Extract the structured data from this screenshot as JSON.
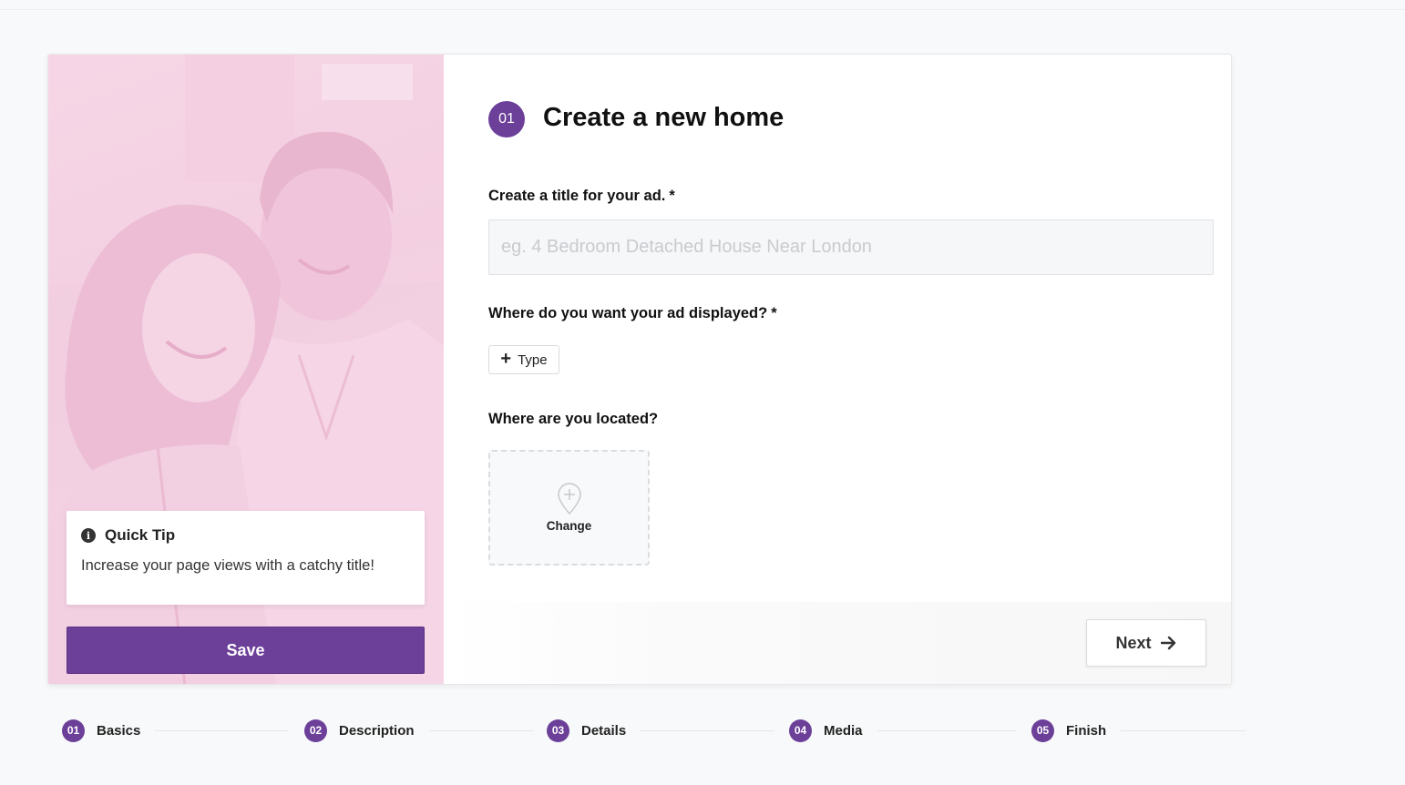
{
  "form": {
    "step_number": "01",
    "title": "Create a new home",
    "title_field": {
      "label": "Create a title for your ad.",
      "required_mark": "*",
      "placeholder": "eg. 4 Bedroom Detached House Near London",
      "value": ""
    },
    "display_field": {
      "label": "Where do you want your ad displayed?",
      "required_mark": "*",
      "type_button": "Type"
    },
    "location_field": {
      "label": "Where are you located?",
      "change_label": "Change"
    },
    "next_button": "Next"
  },
  "sidebar": {
    "tip_title": "Quick Tip",
    "tip_text": "Increase your page views with a catchy title!",
    "save_button": "Save"
  },
  "steps": [
    {
      "number": "01",
      "label": "Basics"
    },
    {
      "number": "02",
      "label": "Description"
    },
    {
      "number": "03",
      "label": "Details"
    },
    {
      "number": "04",
      "label": "Media"
    },
    {
      "number": "05",
      "label": "Finish"
    }
  ],
  "colors": {
    "accent": "#6c3f99",
    "image_tint": "#f5d3e4"
  },
  "icons": {
    "info": "info-circle-icon",
    "plus": "plus-icon",
    "pin": "map-pin-plus-icon",
    "arrow": "arrow-right-icon"
  }
}
